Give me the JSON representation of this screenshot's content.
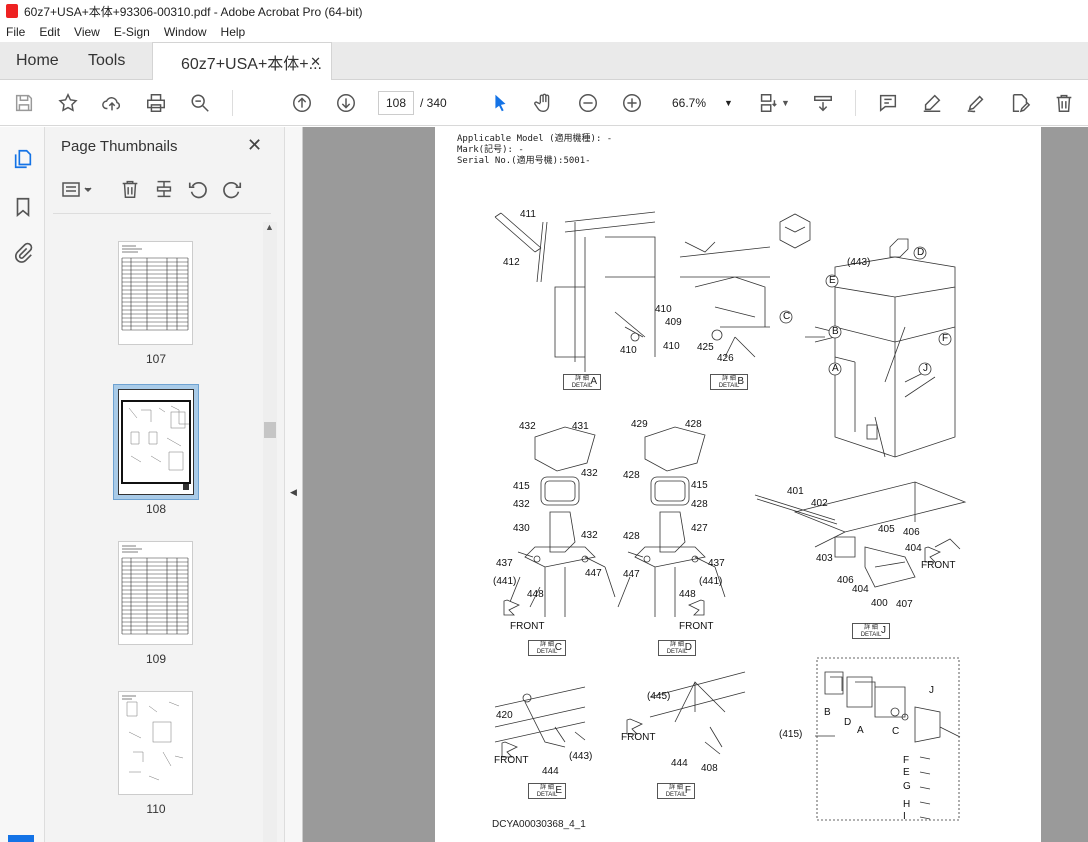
{
  "window": {
    "title": "60z7+USA+本体+93306-00310.pdf - Adobe Acrobat Pro (64-bit)"
  },
  "menu": [
    "File",
    "Edit",
    "View",
    "E-Sign",
    "Window",
    "Help"
  ],
  "tabs": {
    "home": "Home",
    "tools": "Tools",
    "doc": "60z7+USA+本体+..."
  },
  "toolbar": {
    "page_current": "108",
    "page_total": "/ 340",
    "zoom": "66.7%"
  },
  "panel": {
    "title": "Page Thumbnails",
    "thumbnails": [
      {
        "num": "107"
      },
      {
        "num": "108"
      },
      {
        "num": "109"
      },
      {
        "num": "110"
      }
    ]
  },
  "document": {
    "header": [
      "Applicable Model (適用機種): -",
      "Mark(記号): -",
      "Serial No.(適用号機):5001-"
    ],
    "detail_text_jp": "詳 細",
    "detail_text_en": "DETAIL",
    "details": {
      "A": "A",
      "B": "B",
      "C": "C",
      "D": "D",
      "E": "E",
      "F": "F",
      "J": "J"
    },
    "labels": {
      "n411": "411",
      "n412": "412",
      "n410a": "410",
      "n409": "409",
      "n410b": "410",
      "n410c": "410",
      "n425": "425",
      "n426": "426",
      "n443": "(443)",
      "cD": "D",
      "cE": "E",
      "cC": "C",
      "cB": "B",
      "cF": "F",
      "cA": "A",
      "cJ": "J",
      "n432a": "432",
      "n431": "431",
      "n432b": "432",
      "n415a": "415",
      "n432c": "432",
      "n430": "430",
      "n432d": "432",
      "n437a": "437",
      "n441a": "(441)",
      "n447a": "447",
      "n448a": "448",
      "frontC": "FRONT",
      "n429": "429",
      "n428a": "428",
      "n428b": "428",
      "n415b": "415",
      "n428c": "428",
      "n427": "427",
      "n428d": "428",
      "n437b": "437",
      "n447b": "447",
      "n441b": "(441)",
      "n448b": "448",
      "frontD": "FRONT",
      "n401": "401",
      "n402": "402",
      "n405": "405",
      "n406a": "406",
      "n404a": "404",
      "n403": "403",
      "n406b": "406",
      "n404b": "404",
      "n400": "400",
      "n407": "407",
      "frontJ": "FRONT",
      "n420": "420",
      "n443b": "(443)",
      "n444a": "444",
      "frontE": "FRONT",
      "n445": "(445)",
      "n444b": "444",
      "n408": "408",
      "frontF": "FRONT",
      "n415c": "(415)",
      "lB": "B",
      "lD": "D",
      "lA": "A",
      "lC": "C",
      "lJ": "J",
      "lF": "F",
      "lE": "E",
      "lG": "G",
      "lH": "H",
      "lI": "I"
    },
    "footer": "DCYA00030368_4_1"
  }
}
